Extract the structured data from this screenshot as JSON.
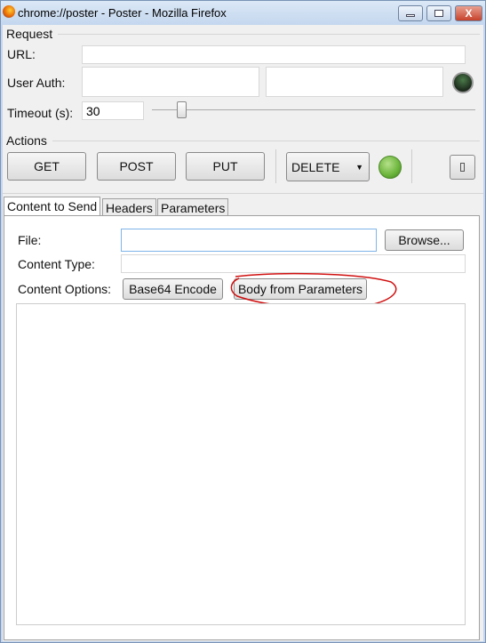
{
  "window": {
    "title": "chrome://poster - Poster - Mozilla Firefox",
    "close_glyph": "X"
  },
  "request": {
    "section": "Request",
    "url_label": "URL:",
    "url_value": "",
    "auth_label": "User Auth:",
    "auth_user": "",
    "auth_pass": "",
    "timeout_label": "Timeout (s):",
    "timeout_value": "30",
    "timeout_slider_fraction": 0.09
  },
  "actions": {
    "section": "Actions",
    "get": "GET",
    "post": "POST",
    "put": "PUT",
    "method_select": "DELETE",
    "status_color": "#6ab43a"
  },
  "tabs": [
    {
      "label": "Content to Send",
      "active": true
    },
    {
      "label": "Headers"
    },
    {
      "label": "Parameters"
    }
  ],
  "content": {
    "file_label": "File:",
    "file_value": "",
    "browse": "Browse...",
    "type_label": "Content Type:",
    "type_value": "",
    "options_label": "Content Options:",
    "base64": "Base64 Encode",
    "body_from_params": "Body from Parameters",
    "body_value": "",
    "annotation_color": "#d01010"
  }
}
